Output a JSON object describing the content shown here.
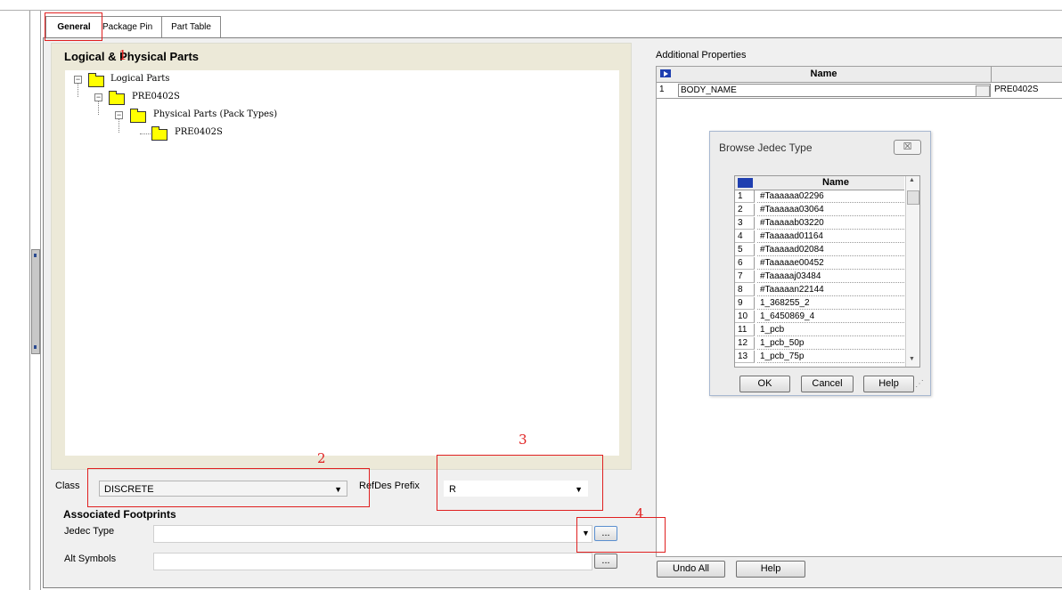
{
  "tabs": [
    {
      "label": "General",
      "active": true
    },
    {
      "label": "Package Pin",
      "active": false
    },
    {
      "label": "Part Table",
      "active": false
    }
  ],
  "left_panel": {
    "title": "Logical & Physical Parts",
    "tree": [
      {
        "label": "Logical Parts",
        "level": 0,
        "expanded": true
      },
      {
        "label": "PRE0402S",
        "level": 1,
        "expanded": true
      },
      {
        "label": "Physical Parts (Pack Types)",
        "level": 2,
        "expanded": true
      },
      {
        "label": "PRE0402S",
        "level": 3,
        "expanded": false
      }
    ]
  },
  "class_field": {
    "label": "Class",
    "value": "DISCRETE"
  },
  "refdes_field": {
    "label": "RefDes Prefix",
    "value": "R"
  },
  "footprints": {
    "title": "Associated Footprints",
    "jedec_label": "Jedec Type",
    "jedec_value": "",
    "alt_label": "Alt Symbols",
    "alt_value": "",
    "browse_label": "..."
  },
  "additional_properties": {
    "title": "Additional Properties",
    "column_header": "Name",
    "rows": [
      {
        "num": "1",
        "name": "BODY_NAME",
        "value": "PRE0402S"
      }
    ]
  },
  "dialog": {
    "title": "Browse Jedec Type",
    "close_label": "☒",
    "column_header": "Name",
    "rows": [
      {
        "num": "1",
        "name": "#Taaaaaa02296"
      },
      {
        "num": "2",
        "name": "#Taaaaaa03064"
      },
      {
        "num": "3",
        "name": "#Taaaaab03220"
      },
      {
        "num": "4",
        "name": "#Taaaaad01164"
      },
      {
        "num": "5",
        "name": "#Taaaaad02084"
      },
      {
        "num": "6",
        "name": "#Taaaaae00452"
      },
      {
        "num": "7",
        "name": "#Taaaaaj03484"
      },
      {
        "num": "8",
        "name": "#Taaaaan22144"
      },
      {
        "num": "9",
        "name": "1_368255_2"
      },
      {
        "num": "10",
        "name": "1_6450869_4"
      },
      {
        "num": "11",
        "name": "1_pcb"
      },
      {
        "num": "12",
        "name": "1_pcb_50p"
      },
      {
        "num": "13",
        "name": "1_pcb_75p"
      }
    ],
    "ok_label": "OK",
    "cancel_label": "Cancel",
    "help_label": "Help"
  },
  "bottom_buttons": {
    "undo_all": "Undo All",
    "help": "Help"
  },
  "annotations": {
    "one": "1",
    "two": "2",
    "three": "3",
    "four": "4"
  },
  "colors": {
    "annotation": "#e02020",
    "folder": "#ffff00",
    "selector": "#1f3fb0"
  }
}
